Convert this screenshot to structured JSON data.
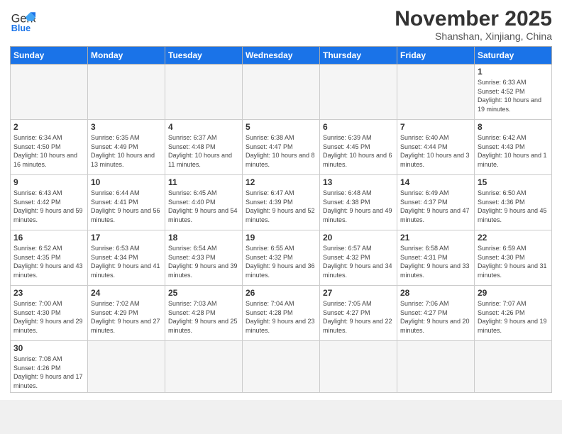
{
  "header": {
    "logo_general": "General",
    "logo_blue": "Blue",
    "month_title": "November 2025",
    "subtitle": "Shanshan, Xinjiang, China"
  },
  "weekdays": [
    "Sunday",
    "Monday",
    "Tuesday",
    "Wednesday",
    "Thursday",
    "Friday",
    "Saturday"
  ],
  "weeks": [
    [
      {
        "day": "",
        "info": ""
      },
      {
        "day": "",
        "info": ""
      },
      {
        "day": "",
        "info": ""
      },
      {
        "day": "",
        "info": ""
      },
      {
        "day": "",
        "info": ""
      },
      {
        "day": "",
        "info": ""
      },
      {
        "day": "1",
        "info": "Sunrise: 6:33 AM\nSunset: 4:52 PM\nDaylight: 10 hours and 19 minutes."
      }
    ],
    [
      {
        "day": "2",
        "info": "Sunrise: 6:34 AM\nSunset: 4:50 PM\nDaylight: 10 hours and 16 minutes."
      },
      {
        "day": "3",
        "info": "Sunrise: 6:35 AM\nSunset: 4:49 PM\nDaylight: 10 hours and 13 minutes."
      },
      {
        "day": "4",
        "info": "Sunrise: 6:37 AM\nSunset: 4:48 PM\nDaylight: 10 hours and 11 minutes."
      },
      {
        "day": "5",
        "info": "Sunrise: 6:38 AM\nSunset: 4:47 PM\nDaylight: 10 hours and 8 minutes."
      },
      {
        "day": "6",
        "info": "Sunrise: 6:39 AM\nSunset: 4:45 PM\nDaylight: 10 hours and 6 minutes."
      },
      {
        "day": "7",
        "info": "Sunrise: 6:40 AM\nSunset: 4:44 PM\nDaylight: 10 hours and 3 minutes."
      },
      {
        "day": "8",
        "info": "Sunrise: 6:42 AM\nSunset: 4:43 PM\nDaylight: 10 hours and 1 minute."
      }
    ],
    [
      {
        "day": "9",
        "info": "Sunrise: 6:43 AM\nSunset: 4:42 PM\nDaylight: 9 hours and 59 minutes."
      },
      {
        "day": "10",
        "info": "Sunrise: 6:44 AM\nSunset: 4:41 PM\nDaylight: 9 hours and 56 minutes."
      },
      {
        "day": "11",
        "info": "Sunrise: 6:45 AM\nSunset: 4:40 PM\nDaylight: 9 hours and 54 minutes."
      },
      {
        "day": "12",
        "info": "Sunrise: 6:47 AM\nSunset: 4:39 PM\nDaylight: 9 hours and 52 minutes."
      },
      {
        "day": "13",
        "info": "Sunrise: 6:48 AM\nSunset: 4:38 PM\nDaylight: 9 hours and 49 minutes."
      },
      {
        "day": "14",
        "info": "Sunrise: 6:49 AM\nSunset: 4:37 PM\nDaylight: 9 hours and 47 minutes."
      },
      {
        "day": "15",
        "info": "Sunrise: 6:50 AM\nSunset: 4:36 PM\nDaylight: 9 hours and 45 minutes."
      }
    ],
    [
      {
        "day": "16",
        "info": "Sunrise: 6:52 AM\nSunset: 4:35 PM\nDaylight: 9 hours and 43 minutes."
      },
      {
        "day": "17",
        "info": "Sunrise: 6:53 AM\nSunset: 4:34 PM\nDaylight: 9 hours and 41 minutes."
      },
      {
        "day": "18",
        "info": "Sunrise: 6:54 AM\nSunset: 4:33 PM\nDaylight: 9 hours and 39 minutes."
      },
      {
        "day": "19",
        "info": "Sunrise: 6:55 AM\nSunset: 4:32 PM\nDaylight: 9 hours and 36 minutes."
      },
      {
        "day": "20",
        "info": "Sunrise: 6:57 AM\nSunset: 4:32 PM\nDaylight: 9 hours and 34 minutes."
      },
      {
        "day": "21",
        "info": "Sunrise: 6:58 AM\nSunset: 4:31 PM\nDaylight: 9 hours and 33 minutes."
      },
      {
        "day": "22",
        "info": "Sunrise: 6:59 AM\nSunset: 4:30 PM\nDaylight: 9 hours and 31 minutes."
      }
    ],
    [
      {
        "day": "23",
        "info": "Sunrise: 7:00 AM\nSunset: 4:30 PM\nDaylight: 9 hours and 29 minutes."
      },
      {
        "day": "24",
        "info": "Sunrise: 7:02 AM\nSunset: 4:29 PM\nDaylight: 9 hours and 27 minutes."
      },
      {
        "day": "25",
        "info": "Sunrise: 7:03 AM\nSunset: 4:28 PM\nDaylight: 9 hours and 25 minutes."
      },
      {
        "day": "26",
        "info": "Sunrise: 7:04 AM\nSunset: 4:28 PM\nDaylight: 9 hours and 23 minutes."
      },
      {
        "day": "27",
        "info": "Sunrise: 7:05 AM\nSunset: 4:27 PM\nDaylight: 9 hours and 22 minutes."
      },
      {
        "day": "28",
        "info": "Sunrise: 7:06 AM\nSunset: 4:27 PM\nDaylight: 9 hours and 20 minutes."
      },
      {
        "day": "29",
        "info": "Sunrise: 7:07 AM\nSunset: 4:26 PM\nDaylight: 9 hours and 19 minutes."
      }
    ],
    [
      {
        "day": "30",
        "info": "Sunrise: 7:08 AM\nSunset: 4:26 PM\nDaylight: 9 hours and 17 minutes."
      },
      {
        "day": "",
        "info": ""
      },
      {
        "day": "",
        "info": ""
      },
      {
        "day": "",
        "info": ""
      },
      {
        "day": "",
        "info": ""
      },
      {
        "day": "",
        "info": ""
      },
      {
        "day": "",
        "info": ""
      }
    ]
  ]
}
